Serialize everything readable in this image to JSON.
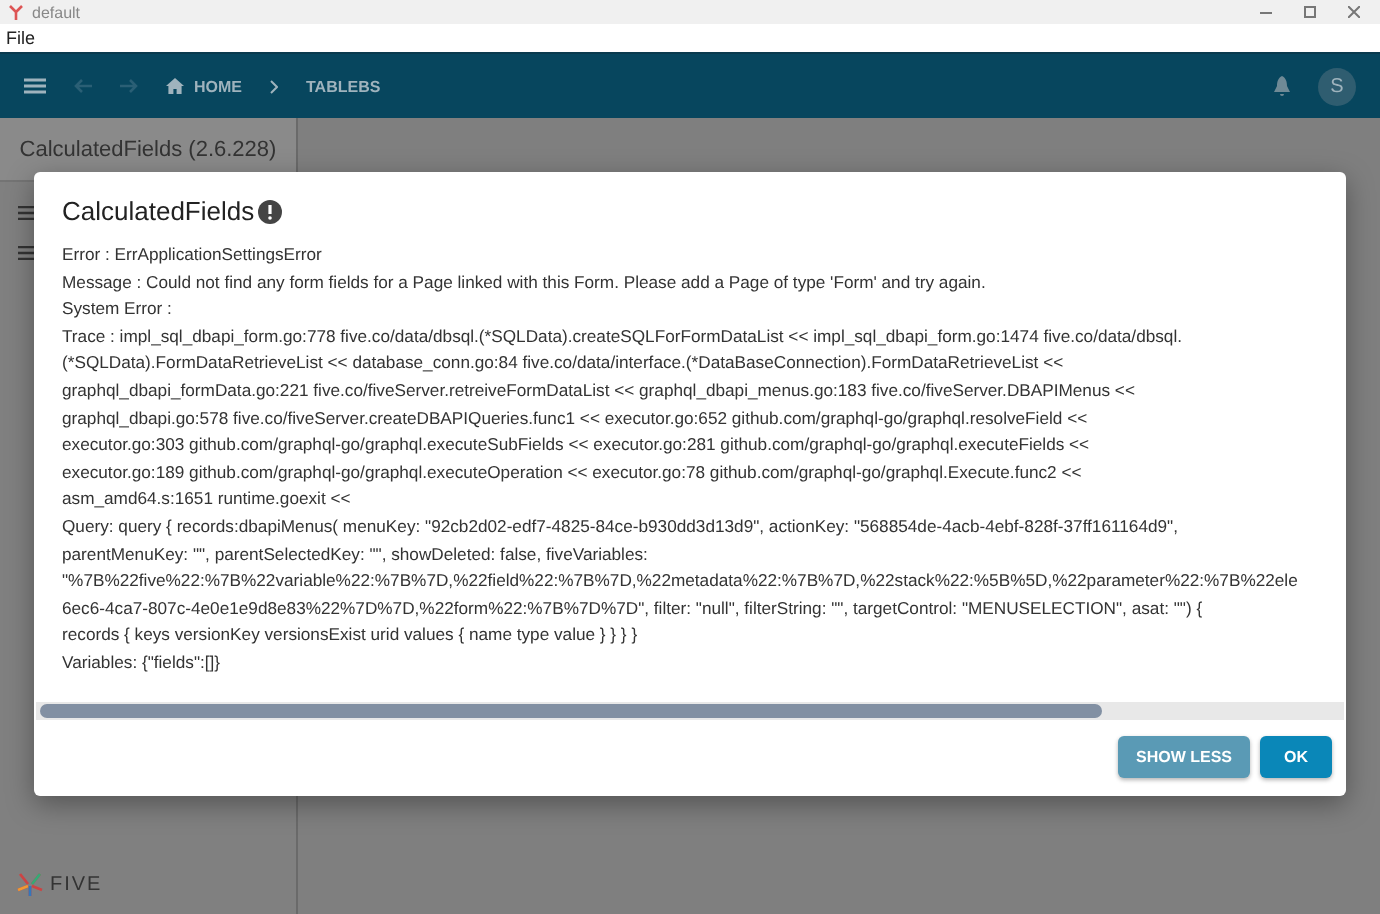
{
  "window": {
    "title": "default"
  },
  "menu": [
    "File"
  ],
  "appbar": {
    "breadcrumbs": [
      {
        "label": "HOME",
        "kind": "home"
      },
      {
        "label": "TABLEBS",
        "kind": "plain"
      }
    ],
    "avatar": "S"
  },
  "sidebar": {
    "title": "CalculatedFields (2.6.228)",
    "brand": "FIVE"
  },
  "dialog": {
    "title": "CalculatedFields",
    "lines": [
      "Error : ErrApplicationSettingsError",
      "Message : Could not find any form fields for a Page linked with this Form. Please add a Page of type 'Form' and try again.",
      "System Error :",
      "Trace : impl_sql_dbapi_form.go:778 five.co/data/dbsql.(*SQLData).createSQLForFormDataList << impl_sql_dbapi_form.go:1474 five.co/data/dbsql.",
      "(*SQLData).FormDataRetrieveList << database_conn.go:84 five.co/data/interface.(*DataBaseConnection).FormDataRetrieveList <<",
      "graphql_dbapi_formData.go:221 five.co/fiveServer.retreiveFormDataList << graphql_dbapi_menus.go:183 five.co/fiveServer.DBAPIMenus <<",
      "graphql_dbapi.go:578 five.co/fiveServer.createDBAPIQueries.func1 << executor.go:652 github.com/graphql-go/graphql.resolveField <<",
      "executor.go:303 github.com/graphql-go/graphql.executeSubFields << executor.go:281 github.com/graphql-go/graphql.executeFields <<",
      "executor.go:189 github.com/graphql-go/graphql.executeOperation << executor.go:78 github.com/graphql-go/graphql.Execute.func2 <<",
      "asm_amd64.s:1651 runtime.goexit <<",
      "Query: query { records:dbapiMenus( menuKey: \"92cb2d02-edf7-4825-84ce-b930dd3d13d9\", actionKey: \"568854de-4acb-4ebf-828f-37ff161164d9\",",
      "parentMenuKey: \"\", parentSelectedKey: \"\", showDeleted: false, fiveVariables:",
      "\"%7B%22five%22:%7B%22variable%22:%7B%7D,%22field%22:%7B%7D,%22metadata%22:%7B%7D,%22stack%22:%5B%5D,%22parameter%22:%7B%22ele",
      "6ec6-4ca7-807c-4e0e1e9d8e83%22%7D%7D,%22form%22:%7B%7D%7D\", filter: \"null\", filterString: \"\", targetControl: \"MENUSELECTION\", asat: \"\") {",
      "records { keys versionKey versionsExist urid values { name type value } } } }",
      "Variables: {\"fields\":[]}"
    ],
    "buttons": [
      {
        "label": "SHOW LESS",
        "kind": "secondary"
      },
      {
        "label": "OK",
        "kind": "primary"
      }
    ]
  }
}
